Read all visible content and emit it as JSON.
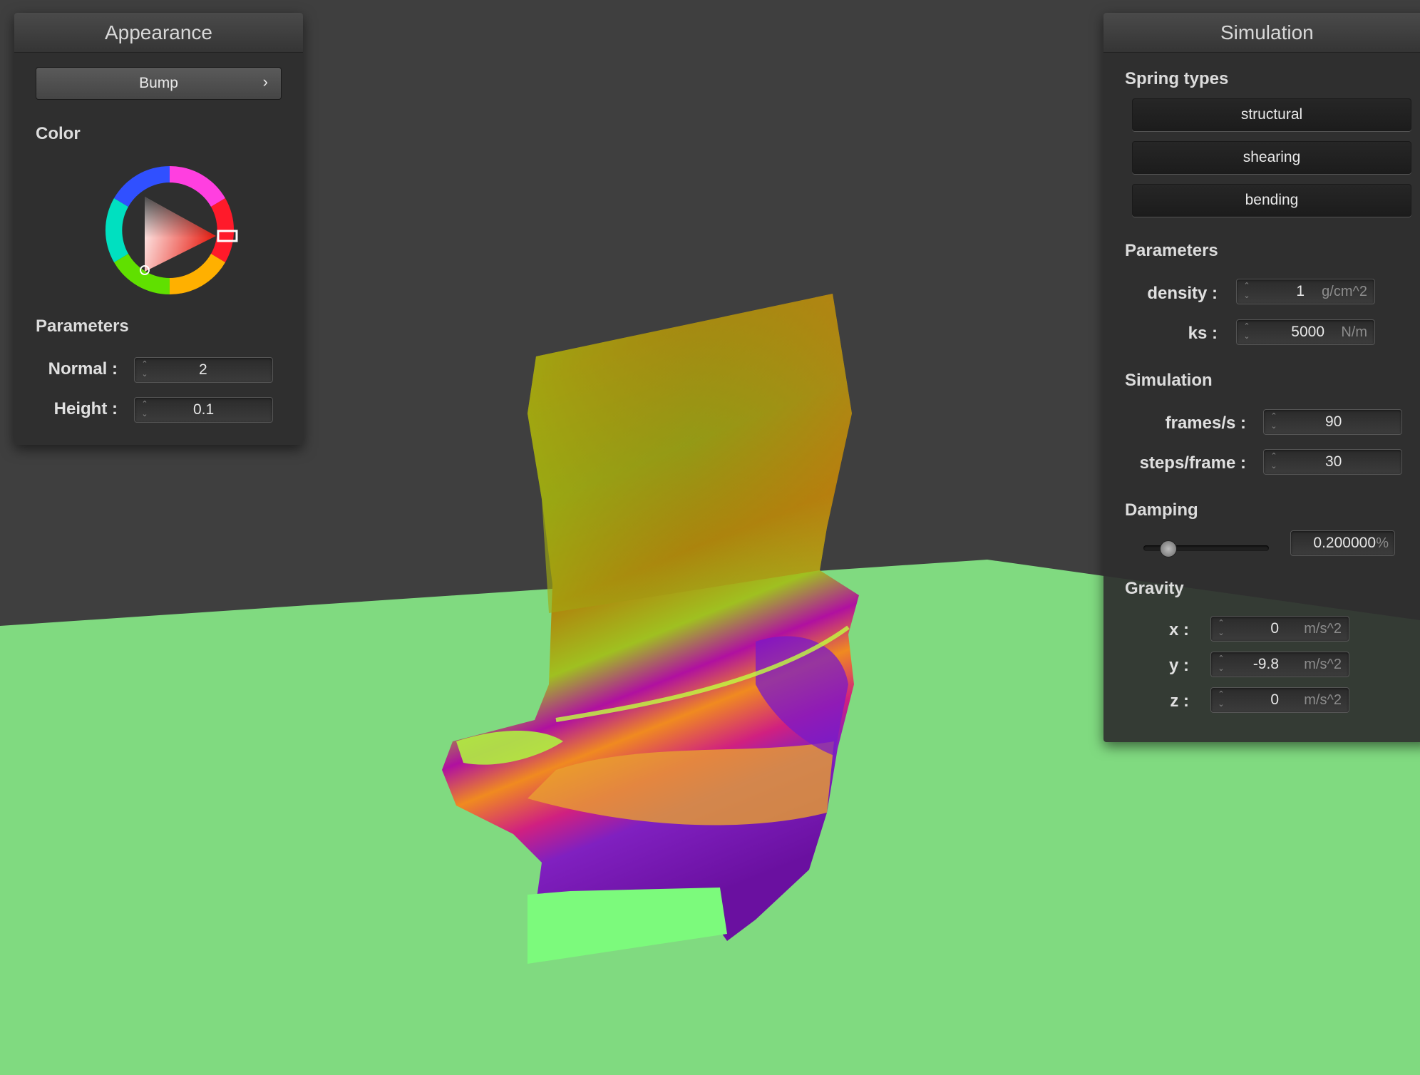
{
  "appearance": {
    "title": "Appearance",
    "shader_button": "Bump",
    "shader_arrow": "›",
    "color_label": "Color",
    "selected_color": "#e8261b",
    "parameters_label": "Parameters",
    "normal_label": "Normal :",
    "normal_value": "2",
    "height_label": "Height :",
    "height_value": "0.1"
  },
  "simulation": {
    "title": "Simulation",
    "spring_types_label": "Spring types",
    "spring_types": [
      "structural",
      "shearing",
      "bending"
    ],
    "parameters_label": "Parameters",
    "density_label": "density :",
    "density_value": "1",
    "density_unit": "g/cm^2",
    "ks_label": "ks :",
    "ks_value": "5000",
    "ks_unit": "N/m",
    "simulation_label": "Simulation",
    "fps_label": "frames/s :",
    "fps_value": "90",
    "steps_label": "steps/frame :",
    "steps_value": "30",
    "damping_label": "Damping",
    "damping_value": "0.200000",
    "damping_unit": "%",
    "damping_level": 0.2,
    "gravity_label": "Gravity",
    "gx_label": "x :",
    "gx_value": "0",
    "gy_label": "y :",
    "gy_value": "-9.8",
    "gz_label": "z :",
    "gz_value": "0",
    "gravity_unit": "m/s^2"
  },
  "colors": {
    "background": "#3f3f3f",
    "floor": "#80da80",
    "panel": "#2e2e2e"
  }
}
